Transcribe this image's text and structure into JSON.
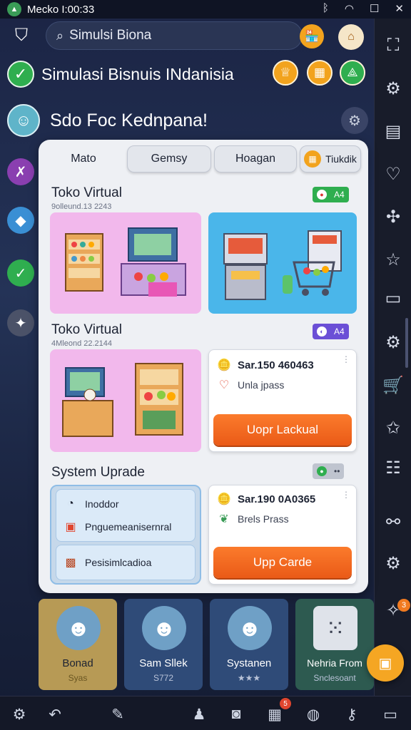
{
  "status": {
    "title": "Mecko I:00:33",
    "icons": [
      "bluetooth-icon",
      "wifi-icon",
      "square-icon",
      "close-icon"
    ]
  },
  "search": {
    "placeholder": "Simulsi Biona"
  },
  "heading": {
    "title": "Simulasi Bisnuis INdanisia"
  },
  "greeting": {
    "text": "Sdo Foc Kednpana!"
  },
  "tabs": [
    "Mato",
    "Gemsy",
    "Hoagan",
    "Tiukdik"
  ],
  "sections": [
    {
      "title": "Toko Virtual",
      "subtitle": "9olleund.13 2243",
      "badge": "A4",
      "badge_color": "#2fae4f"
    },
    {
      "title": "Toko Virtual",
      "subtitle": "4Mleond 22.2144",
      "badge": "A4",
      "badge_color": "#6b4fd6"
    },
    {
      "title": "System Uprade",
      "badge": "••",
      "badge_color": "#2fae4f"
    }
  ],
  "offer1": {
    "price": "Sar.150 460463",
    "label": "Unla jpass",
    "button": "Uopr Lackual"
  },
  "offer2": {
    "price": "Sar.190 0A0365",
    "label": "Brels Prass",
    "button": "Upp Carde"
  },
  "system": {
    "items": [
      "Inoddor",
      "Pnguemeanisernral",
      "Pesisimlcadioa"
    ]
  },
  "people": [
    {
      "name": "Bonad",
      "sub": "Syas",
      "bg": "#b79a55"
    },
    {
      "name": "Sam Sllek",
      "sub": "S772",
      "bg": "#2f4b78"
    },
    {
      "name": "Systanen",
      "sub": "★★★",
      "bg": "#2f4b78"
    },
    {
      "name": "Nehria From",
      "sub": "Snclesoant",
      "bg": "#2d5a50"
    }
  ],
  "rail_badge": "3",
  "bottom_badge": "5",
  "colors": {
    "accent": "#f2a31e",
    "button": "#ea5a17",
    "success": "#2fae4f"
  }
}
